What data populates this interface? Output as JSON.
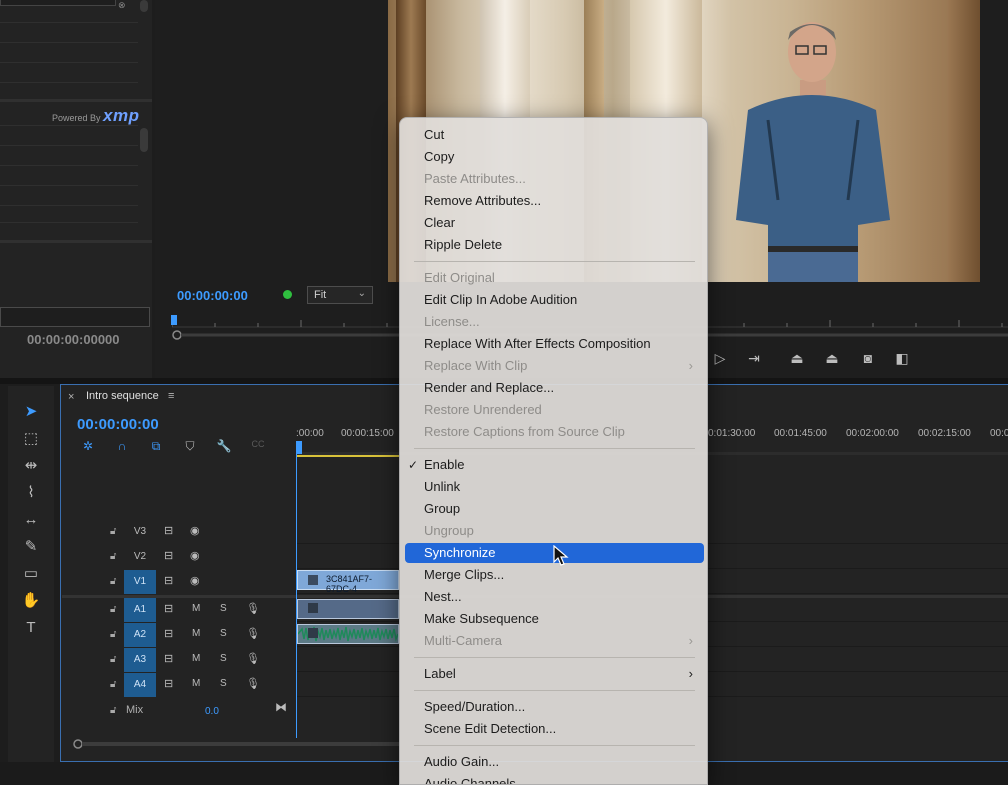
{
  "metadata_panel": {
    "powered_by": "Powered By",
    "brand": "xmp",
    "timecode": "00:00:00:00000"
  },
  "program_monitor": {
    "timecode": "00:00:00:00",
    "zoom": "Fit"
  },
  "timeline": {
    "title": "Intro sequence",
    "close_glyph": "×",
    "menu_glyph": "≡",
    "timecode": "00:00:00:00",
    "ruler_times": [
      ":00:00",
      "00:00:15:00",
      "0:01:30:00",
      "00:01:45:00",
      "00:02:00:00",
      "00:02:15:00",
      "00:0"
    ],
    "video_tracks": [
      {
        "name": "V3",
        "active": false
      },
      {
        "name": "V2",
        "active": false
      },
      {
        "name": "V1",
        "active": true
      }
    ],
    "audio_tracks": [
      {
        "name": "A1",
        "m": "M",
        "s": "S"
      },
      {
        "name": "A2",
        "m": "M",
        "s": "S"
      },
      {
        "name": "A3",
        "m": "M",
        "s": "S"
      },
      {
        "name": "A4",
        "m": "M",
        "s": "S"
      }
    ],
    "mix_label": "Mix",
    "mix_value": "0.0",
    "clip_v1_name": "3C841AF7-67DC-4"
  },
  "context_menu": {
    "highlighted": "Synchronize",
    "items": [
      {
        "label": "Cut",
        "enabled": true
      },
      {
        "label": "Copy",
        "enabled": true
      },
      {
        "label": "Paste Attributes...",
        "enabled": false
      },
      {
        "label": "Remove Attributes...",
        "enabled": true
      },
      {
        "label": "Clear",
        "enabled": true
      },
      {
        "label": "Ripple Delete",
        "enabled": true
      },
      {
        "label": "Edit Original",
        "enabled": false
      },
      {
        "label": "Edit Clip In Adobe Audition",
        "enabled": true
      },
      {
        "label": "License...",
        "enabled": false
      },
      {
        "label": "Replace With After Effects Composition",
        "enabled": true
      },
      {
        "label": "Replace With Clip",
        "enabled": false,
        "submenu": true
      },
      {
        "label": "Render and Replace...",
        "enabled": true
      },
      {
        "label": "Restore Unrendered",
        "enabled": false
      },
      {
        "label": "Restore Captions from Source Clip",
        "enabled": false
      },
      {
        "label": "Enable",
        "enabled": true,
        "checked": true
      },
      {
        "label": "Unlink",
        "enabled": true
      },
      {
        "label": "Group",
        "enabled": true
      },
      {
        "label": "Ungroup",
        "enabled": false
      },
      {
        "label": "Synchronize",
        "enabled": true
      },
      {
        "label": "Merge Clips...",
        "enabled": true
      },
      {
        "label": "Nest...",
        "enabled": true
      },
      {
        "label": "Make Subsequence",
        "enabled": true
      },
      {
        "label": "Multi-Camera",
        "enabled": false,
        "submenu": true
      },
      {
        "label": "Label",
        "enabled": true,
        "submenu": true
      },
      {
        "label": "Speed/Duration...",
        "enabled": true
      },
      {
        "label": "Scene Edit Detection...",
        "enabled": true
      },
      {
        "label": "Audio Gain...",
        "enabled": true
      },
      {
        "label": "Audio Channels...",
        "enabled": true
      }
    ]
  },
  "colors": {
    "accent_blue": "#3d9bff",
    "menu_highlight": "#2167d8",
    "track_active": "#1e5c91"
  }
}
